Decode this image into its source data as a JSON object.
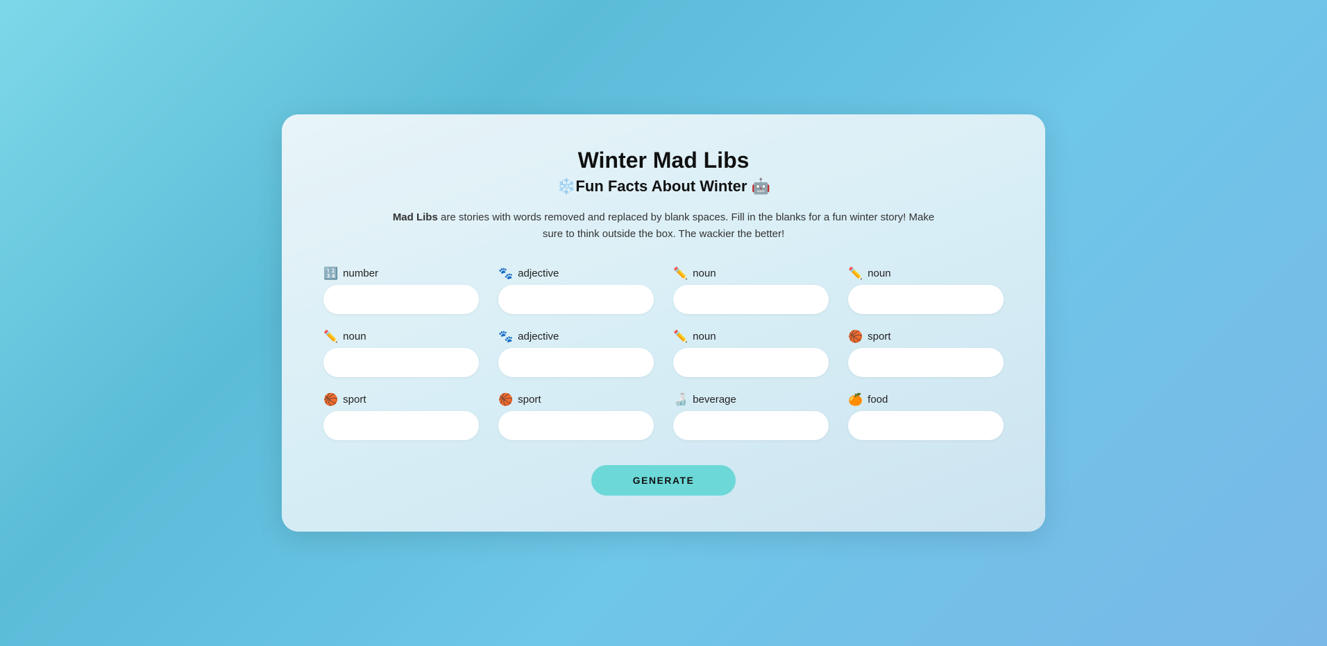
{
  "page": {
    "title": "Winter Mad Libs",
    "subtitle": "❄️Fun Facts About Winter 🤖",
    "description_bold": "Mad Libs",
    "description_rest": " are stories with words removed and replaced by blank spaces. Fill in the blanks for a fun winter story! Make sure to think outside the box. The wackier the better!",
    "generate_button": "GENERATE"
  },
  "fields": [
    {
      "id": "number",
      "label": "number",
      "icon": "🔢",
      "placeholder": ""
    },
    {
      "id": "adjective1",
      "label": "adjective",
      "icon": "🐾",
      "placeholder": ""
    },
    {
      "id": "noun1",
      "label": "noun",
      "icon": "✏️",
      "placeholder": ""
    },
    {
      "id": "noun2",
      "label": "noun",
      "icon": "✏️",
      "placeholder": ""
    },
    {
      "id": "noun3",
      "label": "noun",
      "icon": "✏️",
      "placeholder": ""
    },
    {
      "id": "adjective2",
      "label": "adjective",
      "icon": "🐾",
      "placeholder": ""
    },
    {
      "id": "noun4",
      "label": "noun",
      "icon": "✏️",
      "placeholder": ""
    },
    {
      "id": "sport1",
      "label": "sport",
      "icon": "🏀",
      "placeholder": ""
    },
    {
      "id": "sport2",
      "label": "sport",
      "icon": "🏀",
      "placeholder": ""
    },
    {
      "id": "sport3",
      "label": "sport",
      "icon": "🏀",
      "placeholder": ""
    },
    {
      "id": "beverage",
      "label": "beverage",
      "icon": "🍶",
      "placeholder": ""
    },
    {
      "id": "food",
      "label": "food",
      "icon": "🍊",
      "placeholder": ""
    }
  ]
}
